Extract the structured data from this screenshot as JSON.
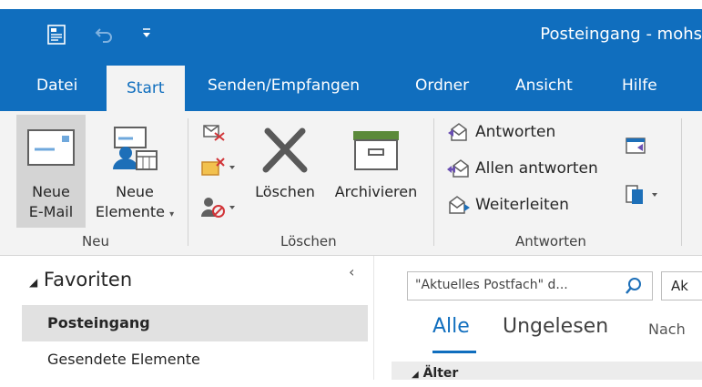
{
  "window": {
    "title": "Posteingang - mohs"
  },
  "quick_access": {
    "icons": [
      "send-receive-all-icon",
      "undo-icon",
      "customize-qat-icon"
    ]
  },
  "tabs": [
    "Datei",
    "Start",
    "Senden/Empfangen",
    "Ordner",
    "Ansicht",
    "Hilfe"
  ],
  "active_tab": "Start",
  "ribbon": {
    "neu": {
      "label": "Neu",
      "new_email": {
        "line1": "Neue",
        "line2": "E-Mail"
      },
      "new_items": {
        "line1": "Neue",
        "line2": "Elemente"
      }
    },
    "loeschen": {
      "label": "Löschen",
      "delete": "Löschen",
      "archive": "Archivieren"
    },
    "antworten": {
      "label": "Antworten",
      "reply": "Antworten",
      "reply_all": "Allen antworten",
      "forward": "Weiterleiten"
    }
  },
  "nav": {
    "favorites": "Favoriten",
    "collapse": "‹",
    "items": [
      "Posteingang",
      "Gesendete Elemente"
    ],
    "selected": "Posteingang"
  },
  "mail_list": {
    "search_placeholder": "\"Aktuelles Postfach\" d...",
    "scope": "Ak",
    "filters": [
      "Alle",
      "Ungelesen",
      "Nach"
    ],
    "active_filter": "Alle",
    "group_header": "Älter"
  },
  "colors": {
    "accent": "#106ebe",
    "ribbon_bg": "#f3f3f3",
    "selected_bg": "#d4d4d4"
  }
}
